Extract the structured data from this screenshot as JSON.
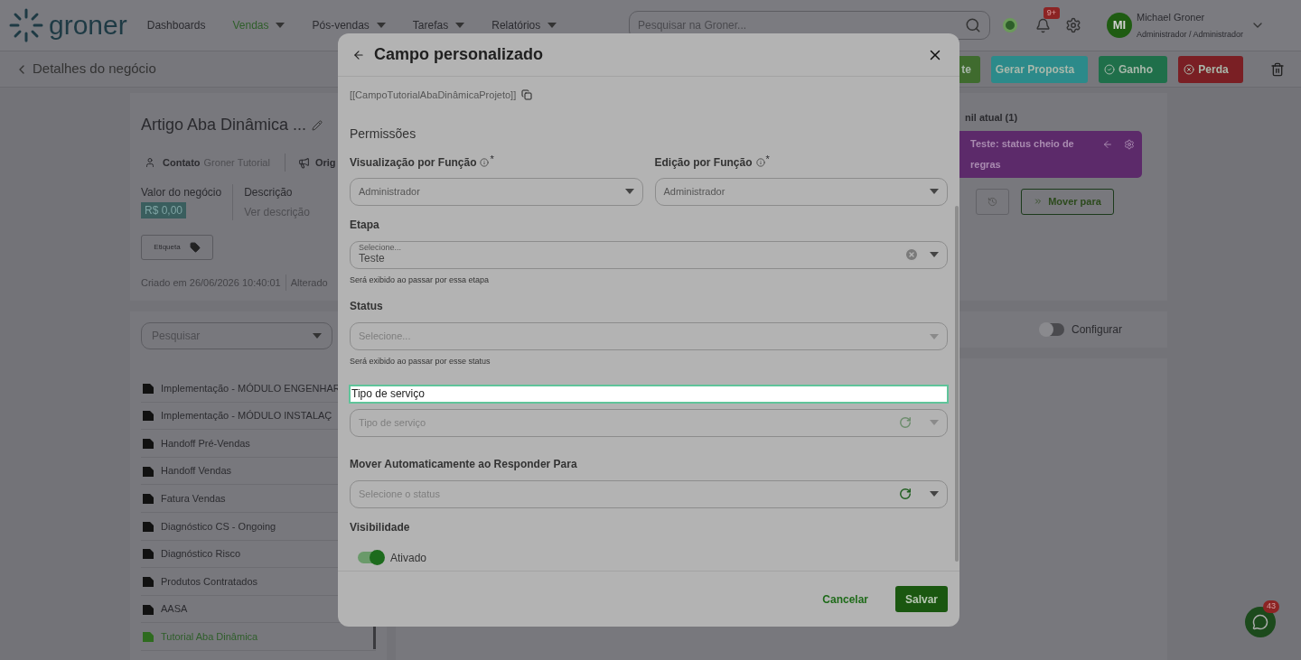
{
  "header": {
    "logo": "groner",
    "nav": [
      {
        "label": "Dashboards",
        "selected": false,
        "dropdown": false
      },
      {
        "label": "Vendas",
        "selected": true,
        "dropdown": true
      },
      {
        "label": "Pós-vendas",
        "selected": false,
        "dropdown": true
      },
      {
        "label": "Tarefas",
        "selected": false,
        "dropdown": true
      },
      {
        "label": "Relatórios",
        "selected": false,
        "dropdown": true
      }
    ],
    "search": {
      "placeholder": "Pesquisar na Groner..."
    },
    "notifications": "9+",
    "user": {
      "initials": "MI",
      "name": "Michael Groner",
      "role": "Administrador / Administrador"
    }
  },
  "subheader": {
    "title": "Detalhes do negócio",
    "buttons": [
      {
        "label": "te",
        "kind": "plain",
        "color": "#3f6b2e"
      },
      {
        "label": "Gerar Proposta",
        "kind": "plain",
        "color": "#2c8a8a"
      },
      {
        "label": "Ganho",
        "kind": "won",
        "color": "#1f6f4a"
      },
      {
        "label": "Perda",
        "kind": "lost",
        "color": "#7a1f24"
      }
    ]
  },
  "deal": {
    "title": "Artigo Aba Dinâmica ...",
    "contact_label": "Contato",
    "contact_value": "Groner Tutorial",
    "origin_label": "Orig",
    "value_label": "Valor do negócio",
    "value": "R$ 0,00",
    "description_label": "Descrição",
    "description_link": "Ver descrição",
    "tag_button": "Etiqueta",
    "created": "Criado em 26/06/2026 10:40:01",
    "changed": "Alterado"
  },
  "funnel": {
    "title": "nil atual (1)",
    "status": "Teste: status cheio de regras",
    "move_button": "Mover para"
  },
  "forms_list": {
    "search_placeholder": "Pesquisar",
    "items": [
      {
        "label": "Implementação - MÓDULO ENGENHAR",
        "selected": false
      },
      {
        "label": "Implementação - MÓDULO INSTALAÇ",
        "selected": false
      },
      {
        "label": "Handoff Pré-Vendas",
        "selected": false
      },
      {
        "label": "Handoff Vendas",
        "selected": false
      },
      {
        "label": "Fatura Vendas",
        "selected": false
      },
      {
        "label": "Diagnóstico CS - Ongoing",
        "selected": false
      },
      {
        "label": "Diagnóstico Risco",
        "selected": false
      },
      {
        "label": "Produtos Contratados",
        "selected": false
      },
      {
        "label": "AASA",
        "selected": false
      },
      {
        "label": "Tutorial Aba Dinâmica",
        "selected": true
      }
    ]
  },
  "configure": {
    "label": "Configurar",
    "on": false
  },
  "chat": {
    "badge": "43"
  },
  "modal": {
    "title": "Campo personalizado",
    "variable": "[[CampoTutorialAbaDinâmicaProjeto]]",
    "section": "Permissões",
    "permissions": [
      {
        "label": "Visualização por Função",
        "required_mark": "*",
        "value": "Administrador"
      },
      {
        "label": "Edição por Função",
        "required_mark": "*",
        "value": "Administrador"
      }
    ],
    "fields": [
      {
        "label": "Etapa",
        "highlighted": false,
        "floating_label": "Selecione...",
        "value": "Teste",
        "clearable": true,
        "hint": "Será exibido ao passar por essa etapa"
      },
      {
        "label": "Status",
        "highlighted": false,
        "placeholder": "Selecione...",
        "clearable": false,
        "hint": "Será exibido ao passar por esse status"
      },
      {
        "label": "Tipo de serviço",
        "highlighted": true,
        "placeholder": "Tipo de serviço",
        "clearable": false,
        "refresh": true,
        "refresh_active": false
      },
      {
        "label": "Mover Automaticamente ao Responder Para",
        "highlighted": false,
        "placeholder": "Selecione o status",
        "clearable": false,
        "refresh": true,
        "refresh_active": true
      }
    ],
    "visibility": {
      "label": "Visibilidade",
      "toggle_label": "Ativado",
      "on": true
    },
    "cancel": "Cancelar",
    "save": "Salvar"
  }
}
